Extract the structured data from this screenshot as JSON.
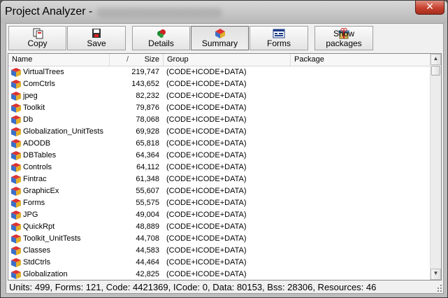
{
  "window": {
    "title": "Project Analyzer - ",
    "close_glyph": "✕"
  },
  "toolbar": {
    "buttons": [
      {
        "label": "Copy",
        "icon": "copy-icon"
      },
      {
        "label": "Save",
        "icon": "save-icon"
      },
      {
        "label": "Details",
        "icon": "details-icon"
      },
      {
        "label": "Summary",
        "icon": "summary-icon"
      },
      {
        "label": "Forms",
        "icon": "forms-icon"
      },
      {
        "label": "Show packages",
        "icon": "packages-icon"
      }
    ]
  },
  "list": {
    "columns": {
      "name": "Name",
      "sort_marker": "/",
      "size": "Size",
      "group": "Group",
      "package": "Package"
    },
    "rows": [
      {
        "name": "VirtualTrees",
        "size": "219,747",
        "group": "(CODE+ICODE+DATA)",
        "package": ""
      },
      {
        "name": "ComCtrls",
        "size": "143,652",
        "group": "(CODE+ICODE+DATA)",
        "package": ""
      },
      {
        "name": "jpeg",
        "size": "82,232",
        "group": "(CODE+ICODE+DATA)",
        "package": ""
      },
      {
        "name": "Toolkit",
        "size": "79,876",
        "group": "(CODE+ICODE+DATA)",
        "package": ""
      },
      {
        "name": "Db",
        "size": "78,068",
        "group": "(CODE+ICODE+DATA)",
        "package": ""
      },
      {
        "name": "Globalization_UnitTests",
        "size": "69,928",
        "group": "(CODE+ICODE+DATA)",
        "package": ""
      },
      {
        "name": "ADODB",
        "size": "65,818",
        "group": "(CODE+ICODE+DATA)",
        "package": ""
      },
      {
        "name": "DBTables",
        "size": "64,364",
        "group": "(CODE+ICODE+DATA)",
        "package": ""
      },
      {
        "name": "Controls",
        "size": "64,112",
        "group": "(CODE+ICODE+DATA)",
        "package": ""
      },
      {
        "name": "Fintrac",
        "size": "61,348",
        "group": "(CODE+ICODE+DATA)",
        "package": ""
      },
      {
        "name": "GraphicEx",
        "size": "55,607",
        "group": "(CODE+ICODE+DATA)",
        "package": ""
      },
      {
        "name": "Forms",
        "size": "55,575",
        "group": "(CODE+ICODE+DATA)",
        "package": ""
      },
      {
        "name": "JPG",
        "size": "49,004",
        "group": "(CODE+ICODE+DATA)",
        "package": ""
      },
      {
        "name": "QuickRpt",
        "size": "48,889",
        "group": "(CODE+ICODE+DATA)",
        "package": ""
      },
      {
        "name": "Toolkit_UnitTests",
        "size": "44,708",
        "group": "(CODE+ICODE+DATA)",
        "package": ""
      },
      {
        "name": "Classes",
        "size": "44,583",
        "group": "(CODE+ICODE+DATA)",
        "package": ""
      },
      {
        "name": "StdCtrls",
        "size": "44,464",
        "group": "(CODE+ICODE+DATA)",
        "package": ""
      },
      {
        "name": "Globalization",
        "size": "42,825",
        "group": "(CODE+ICODE+DATA)",
        "package": ""
      }
    ],
    "row_icon": "unit-icon",
    "scroll_up": "▲",
    "scroll_down": "▼"
  },
  "status": {
    "text": "Units: 499, Forms: 121, Code: 4421369, ICode: 0, Data: 80153, Bss: 28306, Resources: 46"
  },
  "colors": {
    "title_bar": "#c4c4c4",
    "close_button": "#c7412e",
    "panel": "#f0f0f0",
    "list_bg": "#ffffff"
  }
}
